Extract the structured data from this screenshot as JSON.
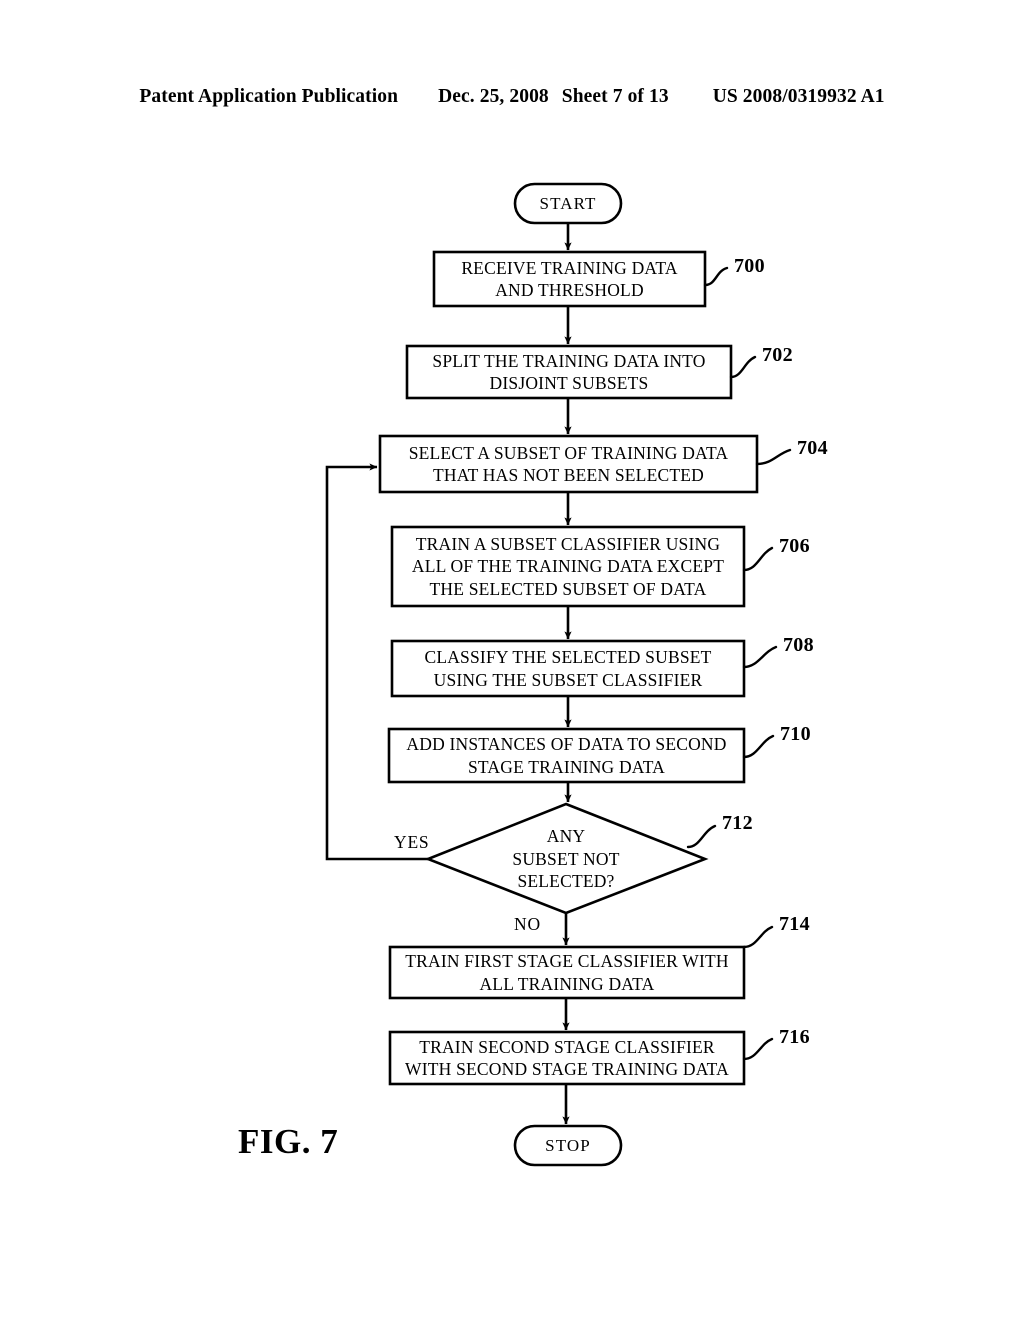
{
  "header": {
    "publication": "Patent Application Publication",
    "date": "Dec. 25, 2008",
    "sheet": "Sheet 7 of 13",
    "patent_number": "US 2008/0319932 A1"
  },
  "figure": {
    "label": "FIG. 7"
  },
  "flowchart": {
    "start": {
      "label": "START"
    },
    "stop": {
      "label": "STOP"
    },
    "nodes": [
      {
        "ref": "700",
        "lines": [
          "RECEIVE TRAINING DATA",
          "AND THRESHOLD"
        ]
      },
      {
        "ref": "702",
        "lines": [
          "SPLIT THE TRAINING DATA INTO",
          "DISJOINT SUBSETS"
        ]
      },
      {
        "ref": "704",
        "lines": [
          "SELECT A SUBSET OF TRAINING DATA",
          "THAT HAS NOT BEEN SELECTED"
        ]
      },
      {
        "ref": "706",
        "lines": [
          "TRAIN A SUBSET CLASSIFIER USING",
          "ALL OF THE TRAINING DATA EXCEPT",
          "THE SELECTED SUBSET OF DATA"
        ]
      },
      {
        "ref": "708",
        "lines": [
          "CLASSIFY THE SELECTED SUBSET",
          "USING THE SUBSET CLASSIFIER"
        ]
      },
      {
        "ref": "710",
        "lines": [
          "ADD  INSTANCES OF DATA TO SECOND",
          "STAGE TRAINING DATA"
        ]
      },
      {
        "ref": "712",
        "lines": [
          "ANY",
          "SUBSET NOT",
          "SELECTED?"
        ]
      },
      {
        "ref": "714",
        "lines": [
          "TRAIN FIRST STAGE CLASSIFIER WITH",
          "ALL TRAINING DATA"
        ]
      },
      {
        "ref": "716",
        "lines": [
          "TRAIN SECOND STAGE CLASSIFIER",
          "WITH SECOND STAGE TRAINING DATA"
        ]
      }
    ],
    "edge_labels": {
      "yes": "YES",
      "no": "NO"
    }
  }
}
